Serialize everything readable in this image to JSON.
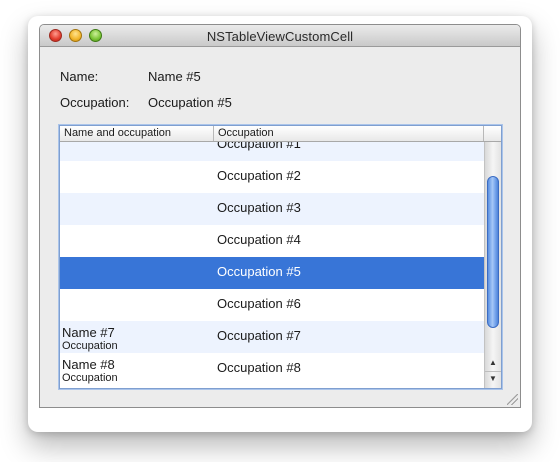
{
  "window": {
    "title": "NSTableViewCustomCell"
  },
  "detail": {
    "name_label": "Name:",
    "name_value": "Name #5",
    "occupation_label": "Occupation:",
    "occupation_value": "Occupation #5"
  },
  "table": {
    "columns": [
      "Name and occupation",
      "Occupation"
    ],
    "rows": [
      {
        "name": "",
        "occupation_small": "",
        "occupation": "Occupation #1"
      },
      {
        "name": "",
        "occupation_small": "",
        "occupation": "Occupation #2"
      },
      {
        "name": "",
        "occupation_small": "",
        "occupation": "Occupation #3"
      },
      {
        "name": "",
        "occupation_small": "",
        "occupation": "Occupation #4"
      },
      {
        "name": "",
        "occupation_small": "",
        "occupation": "Occupation #5"
      },
      {
        "name": "",
        "occupation_small": "",
        "occupation": "Occupation #6"
      },
      {
        "name": "Name #7",
        "occupation_small": "Occupation",
        "occupation": "Occupation #7"
      },
      {
        "name": "Name #8",
        "occupation_small": "Occupation",
        "occupation": "Occupation #8"
      }
    ],
    "selected_row": "Occupation #5"
  },
  "icons": {
    "close": "close-button",
    "minimize": "minimize-button",
    "zoom": "zoom-button",
    "scroll_up": "up-arrow-icon",
    "scroll_down": "down-arrow-icon",
    "resize": "resize-grip-icon"
  },
  "colors": {
    "selection": "#3875d7",
    "alternate_row": "#edf3fe",
    "scroll_knob": "#5a8fe0"
  }
}
